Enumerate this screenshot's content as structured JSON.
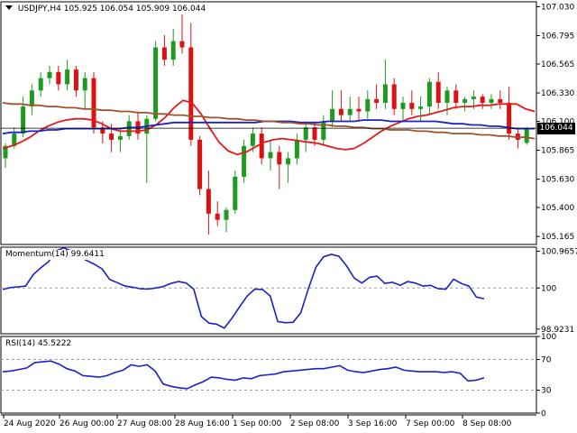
{
  "header": {
    "symbol": "USDJPY,H4",
    "ohlc": "105.925 106.054 105.909 106.044"
  },
  "current_price_label": "106.044",
  "momentum_header": "Momentum(14) 99.6411",
  "rsi_header": "RSI(14) 45.5222",
  "colors": {
    "bull": "#1e9a1e",
    "bear": "#dd1111",
    "ma_red": "#e31b1b",
    "ma_blue": "#1a22c8",
    "ma_brown": "#a0522d",
    "indicator_line": "#1a22c8",
    "grid_dash": "#a0a0a0"
  },
  "chart_data": [
    {
      "type": "candlestick",
      "title": "USDJPY,H4",
      "ylim": [
        105.1,
        107.07
      ],
      "y_ticks": [
        "107.030",
        "106.795",
        "106.565",
        "106.330",
        "106.100",
        "105.865",
        "105.630",
        "105.400",
        "105.165"
      ],
      "x_ticks": [
        "24 Aug 2020",
        "26 Aug 00:00",
        "27 Aug 08:00",
        "28 Aug 16:00",
        "1 Sep 00:00",
        "2 Sep 08:00",
        "3 Sep 16:00",
        "7 Sep 00:00",
        "8 Sep 08:00"
      ],
      "current_price": 106.044,
      "candles": [
        {
          "o": 105.8,
          "h": 105.92,
          "l": 105.72,
          "c": 105.9
        },
        {
          "o": 105.9,
          "h": 106.05,
          "l": 105.88,
          "c": 106.0
        },
        {
          "o": 106.0,
          "h": 106.3,
          "l": 105.97,
          "c": 106.22
        },
        {
          "o": 106.22,
          "h": 106.4,
          "l": 106.15,
          "c": 106.35
        },
        {
          "o": 106.35,
          "h": 106.5,
          "l": 106.3,
          "c": 106.45
        },
        {
          "o": 106.45,
          "h": 106.55,
          "l": 106.4,
          "c": 106.5
        },
        {
          "o": 106.5,
          "h": 106.55,
          "l": 106.35,
          "c": 106.4
        },
        {
          "o": 106.4,
          "h": 106.6,
          "l": 106.35,
          "c": 106.52
        },
        {
          "o": 106.52,
          "h": 106.55,
          "l": 106.3,
          "c": 106.35
        },
        {
          "o": 106.35,
          "h": 106.5,
          "l": 106.2,
          "c": 106.45
        },
        {
          "o": 106.45,
          "h": 106.5,
          "l": 106.0,
          "c": 106.05
        },
        {
          "o": 106.05,
          "h": 106.1,
          "l": 105.92,
          "c": 106.0
        },
        {
          "o": 106.0,
          "h": 106.08,
          "l": 105.85,
          "c": 105.95
        },
        {
          "o": 105.95,
          "h": 106.05,
          "l": 105.85,
          "c": 105.98
        },
        {
          "o": 105.98,
          "h": 106.15,
          "l": 105.95,
          "c": 106.1
        },
        {
          "o": 106.1,
          "h": 106.18,
          "l": 105.95,
          "c": 106.0
        },
        {
          "o": 106.0,
          "h": 106.15,
          "l": 105.6,
          "c": 106.12
        },
        {
          "o": 106.12,
          "h": 106.75,
          "l": 106.1,
          "c": 106.7
        },
        {
          "o": 106.7,
          "h": 106.8,
          "l": 106.55,
          "c": 106.6
        },
        {
          "o": 106.6,
          "h": 106.85,
          "l": 106.55,
          "c": 106.75
        },
        {
          "o": 106.75,
          "h": 107.0,
          "l": 106.65,
          "c": 106.7
        },
        {
          "o": 106.7,
          "h": 106.9,
          "l": 105.9,
          "c": 105.95
        },
        {
          "o": 105.95,
          "h": 105.98,
          "l": 105.5,
          "c": 105.55
        },
        {
          "o": 105.55,
          "h": 105.7,
          "l": 105.18,
          "c": 105.35
        },
        {
          "o": 105.35,
          "h": 105.45,
          "l": 105.25,
          "c": 105.3
        },
        {
          "o": 105.3,
          "h": 105.4,
          "l": 105.2,
          "c": 105.38
        },
        {
          "o": 105.38,
          "h": 105.7,
          "l": 105.35,
          "c": 105.65
        },
        {
          "o": 105.65,
          "h": 105.95,
          "l": 105.6,
          "c": 105.9
        },
        {
          "o": 105.9,
          "h": 106.05,
          "l": 105.85,
          "c": 106.0
        },
        {
          "o": 106.0,
          "h": 106.05,
          "l": 105.75,
          "c": 105.8
        },
        {
          "o": 105.8,
          "h": 105.95,
          "l": 105.7,
          "c": 105.85
        },
        {
          "o": 105.85,
          "h": 105.9,
          "l": 105.55,
          "c": 105.75
        },
        {
          "o": 105.75,
          "h": 105.85,
          "l": 105.6,
          "c": 105.8
        },
        {
          "o": 105.8,
          "h": 106.0,
          "l": 105.75,
          "c": 105.95
        },
        {
          "o": 105.95,
          "h": 106.1,
          "l": 105.85,
          "c": 106.05
        },
        {
          "o": 106.05,
          "h": 106.1,
          "l": 105.9,
          "c": 105.95
        },
        {
          "o": 105.95,
          "h": 106.15,
          "l": 105.9,
          "c": 106.1
        },
        {
          "o": 106.1,
          "h": 106.35,
          "l": 106.05,
          "c": 106.2
        },
        {
          "o": 106.2,
          "h": 106.35,
          "l": 106.1,
          "c": 106.15
        },
        {
          "o": 106.15,
          "h": 106.3,
          "l": 106.1,
          "c": 106.2
        },
        {
          "o": 106.2,
          "h": 106.3,
          "l": 106.1,
          "c": 106.18
        },
        {
          "o": 106.18,
          "h": 106.35,
          "l": 106.12,
          "c": 106.28
        },
        {
          "o": 106.28,
          "h": 106.4,
          "l": 106.2,
          "c": 106.25
        },
        {
          "o": 106.25,
          "h": 106.6,
          "l": 106.2,
          "c": 106.4
        },
        {
          "o": 106.4,
          "h": 106.45,
          "l": 106.15,
          "c": 106.2
        },
        {
          "o": 106.2,
          "h": 106.3,
          "l": 106.1,
          "c": 106.25
        },
        {
          "o": 106.25,
          "h": 106.35,
          "l": 106.15,
          "c": 106.2
        },
        {
          "o": 106.2,
          "h": 106.3,
          "l": 106.1,
          "c": 106.22
        },
        {
          "o": 106.22,
          "h": 106.45,
          "l": 106.15,
          "c": 106.42
        },
        {
          "o": 106.42,
          "h": 106.5,
          "l": 106.2,
          "c": 106.25
        },
        {
          "o": 106.25,
          "h": 106.38,
          "l": 106.15,
          "c": 106.35
        },
        {
          "o": 106.35,
          "h": 106.4,
          "l": 106.2,
          "c": 106.25
        },
        {
          "o": 106.25,
          "h": 106.3,
          "l": 106.18,
          "c": 106.28
        },
        {
          "o": 106.28,
          "h": 106.35,
          "l": 106.2,
          "c": 106.3
        },
        {
          "o": 106.3,
          "h": 106.32,
          "l": 106.2,
          "c": 106.25
        },
        {
          "o": 106.25,
          "h": 106.32,
          "l": 106.2,
          "c": 106.28
        },
        {
          "o": 106.28,
          "h": 106.35,
          "l": 106.2,
          "c": 106.25
        },
        {
          "o": 106.25,
          "h": 106.38,
          "l": 105.95,
          "c": 106.0
        },
        {
          "o": 106.0,
          "h": 106.05,
          "l": 105.88,
          "c": 105.95
        },
        {
          "o": 105.925,
          "h": 106.054,
          "l": 105.909,
          "c": 106.044
        }
      ],
      "series": [
        {
          "name": "",
          "color": "#e31b1b",
          "values": [
            105.88,
            105.9,
            105.93,
            105.97,
            106.02,
            106.06,
            106.09,
            106.11,
            106.12,
            106.12,
            106.11,
            106.08,
            106.04,
            106.02,
            106.02,
            106.02,
            106.03,
            106.07,
            106.13,
            106.21,
            106.27,
            106.25,
            106.16,
            106.04,
            105.93,
            105.86,
            105.83,
            105.85,
            105.89,
            105.93,
            105.95,
            105.96,
            105.95,
            105.94,
            105.93,
            105.92,
            105.9,
            105.88,
            105.87,
            105.88,
            105.92,
            105.97,
            106.02,
            106.06,
            106.09,
            106.12,
            106.14,
            106.15,
            106.17,
            106.19,
            106.21,
            106.22,
            106.22,
            106.23,
            106.23,
            106.24,
            106.24,
            106.24,
            106.2,
            106.18
          ]
        },
        {
          "name": "",
          "color": "#1a22c8",
          "values": [
            106.0,
            106.01,
            106.01,
            106.02,
            106.02,
            106.03,
            106.03,
            106.04,
            106.04,
            106.04,
            106.04,
            106.04,
            106.04,
            106.04,
            106.05,
            106.05,
            106.06,
            106.07,
            106.08,
            106.09,
            106.09,
            106.09,
            106.09,
            106.09,
            106.09,
            106.09,
            106.09,
            106.09,
            106.09,
            106.1,
            106.1,
            106.1,
            106.1,
            106.09,
            106.09,
            106.09,
            106.1,
            106.1,
            106.1,
            106.1,
            106.11,
            106.11,
            106.11,
            106.1,
            106.1,
            106.1,
            106.1,
            106.1,
            106.1,
            106.09,
            106.08,
            106.08,
            106.07,
            106.07,
            106.06,
            106.06,
            106.05,
            106.04,
            106.04,
            106.04
          ]
        },
        {
          "name": "",
          "color": "#a0522d",
          "values": [
            106.25,
            106.24,
            106.24,
            106.23,
            106.23,
            106.22,
            106.22,
            106.21,
            106.21,
            106.2,
            106.2,
            106.19,
            106.19,
            106.18,
            106.18,
            106.17,
            106.17,
            106.16,
            106.16,
            106.15,
            106.15,
            106.14,
            106.14,
            106.13,
            106.13,
            106.12,
            106.12,
            106.11,
            106.11,
            106.1,
            106.1,
            106.09,
            106.09,
            106.08,
            106.08,
            106.07,
            106.07,
            106.06,
            106.06,
            106.05,
            106.05,
            106.04,
            106.04,
            106.03,
            106.03,
            106.03,
            106.02,
            106.02,
            106.01,
            106.01,
            106.0,
            106.0,
            106.0,
            105.99,
            105.99,
            105.98,
            105.98,
            105.97,
            105.97,
            105.96
          ]
        }
      ]
    },
    {
      "type": "line",
      "title": "Momentum(14) 99.6411",
      "ylim": [
        98.8,
        101.07
      ],
      "y_ticks": [
        "100.9657",
        "100",
        "98.9231"
      ],
      "reference_line": 100,
      "series": [
        {
          "name": "",
          "values": [
            99.96,
            100.01,
            100.03,
            100.05,
            100.35,
            100.53,
            100.69,
            100.98,
            101.05,
            100.97,
            100.82,
            100.72,
            100.62,
            100.5,
            100.22,
            100.14,
            100.05,
            100.02,
            99.98,
            99.97,
            100.0,
            100.04,
            100.12,
            100.17,
            100.13,
            99.97,
            99.25,
            99.08,
            99.05,
            98.95,
            99.21,
            99.51,
            99.79,
            99.97,
            99.96,
            99.79,
            99.12,
            99.09,
            99.1,
            99.35,
            99.98,
            100.55,
            100.82,
            100.88,
            100.83,
            100.58,
            100.26,
            100.13,
            100.28,
            100.31,
            100.12,
            100.15,
            100.07,
            100.17,
            100.13,
            100.05,
            100.07,
            99.98,
            99.97,
            100.23,
            100.12,
            100.05,
            99.76,
            99.72
          ]
        }
      ]
    },
    {
      "type": "line",
      "title": "RSI(14) 45.5222",
      "ylim": [
        0,
        100
      ],
      "y_ticks": [
        "100",
        "70",
        "30",
        "0"
      ],
      "reference_lines": [
        70,
        30
      ],
      "series": [
        {
          "name": "",
          "values": [
            54,
            55,
            57,
            59,
            66,
            67,
            68,
            64,
            58,
            55,
            49,
            48,
            47,
            49,
            53,
            56,
            63,
            61,
            63,
            55,
            38,
            35,
            33,
            32,
            37,
            41,
            47,
            46,
            44,
            43,
            46,
            45,
            49,
            50,
            51,
            54,
            55,
            56,
            57,
            58,
            58,
            60,
            62,
            56,
            54,
            53,
            55,
            57,
            58,
            60,
            56,
            55,
            54,
            54,
            54,
            53,
            54,
            52,
            42,
            43,
            46
          ]
        }
      ]
    }
  ]
}
